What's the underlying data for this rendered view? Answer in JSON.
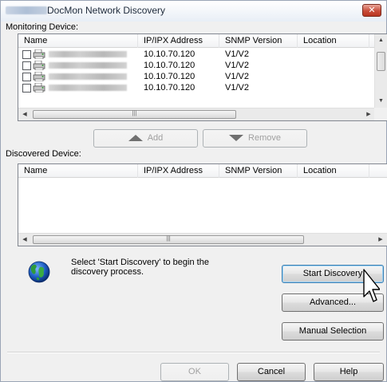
{
  "window": {
    "title": "DocMon Network Discovery",
    "close_label": "✕"
  },
  "monitoring": {
    "label": "Monitoring Device:",
    "columns": [
      "Name",
      "IP/IPX Address",
      "SNMP Version",
      "Location"
    ],
    "rows": [
      {
        "ip": "10.10.70.120",
        "snmp": "V1/V2",
        "location": ""
      },
      {
        "ip": "10.10.70.120",
        "snmp": "V1/V2",
        "location": ""
      },
      {
        "ip": "10.10.70.120",
        "snmp": "V1/V2",
        "location": ""
      },
      {
        "ip": "10.10.70.120",
        "snmp": "V1/V2",
        "location": ""
      }
    ],
    "hscroll_grip": "|||"
  },
  "actions": {
    "add_label": "Add",
    "remove_label": "Remove"
  },
  "discovered": {
    "label": "Discovered Device:",
    "columns": [
      "Name",
      "IP/IPX Address",
      "SNMP Version",
      "Location"
    ],
    "hscroll_grip": "|||"
  },
  "info": {
    "line1": "Select 'Start Discovery' to begin the",
    "line2": "discovery process."
  },
  "buttons": {
    "start_discovery": "Start Discovery",
    "advanced": "Advanced...",
    "manual_selection": "Manual Selection",
    "ok": "OK",
    "cancel": "Cancel",
    "help": "Help"
  },
  "icons": {
    "device": "printer-icon",
    "globe": "globe-icon",
    "cursor": "mouse-pointer-icon"
  }
}
